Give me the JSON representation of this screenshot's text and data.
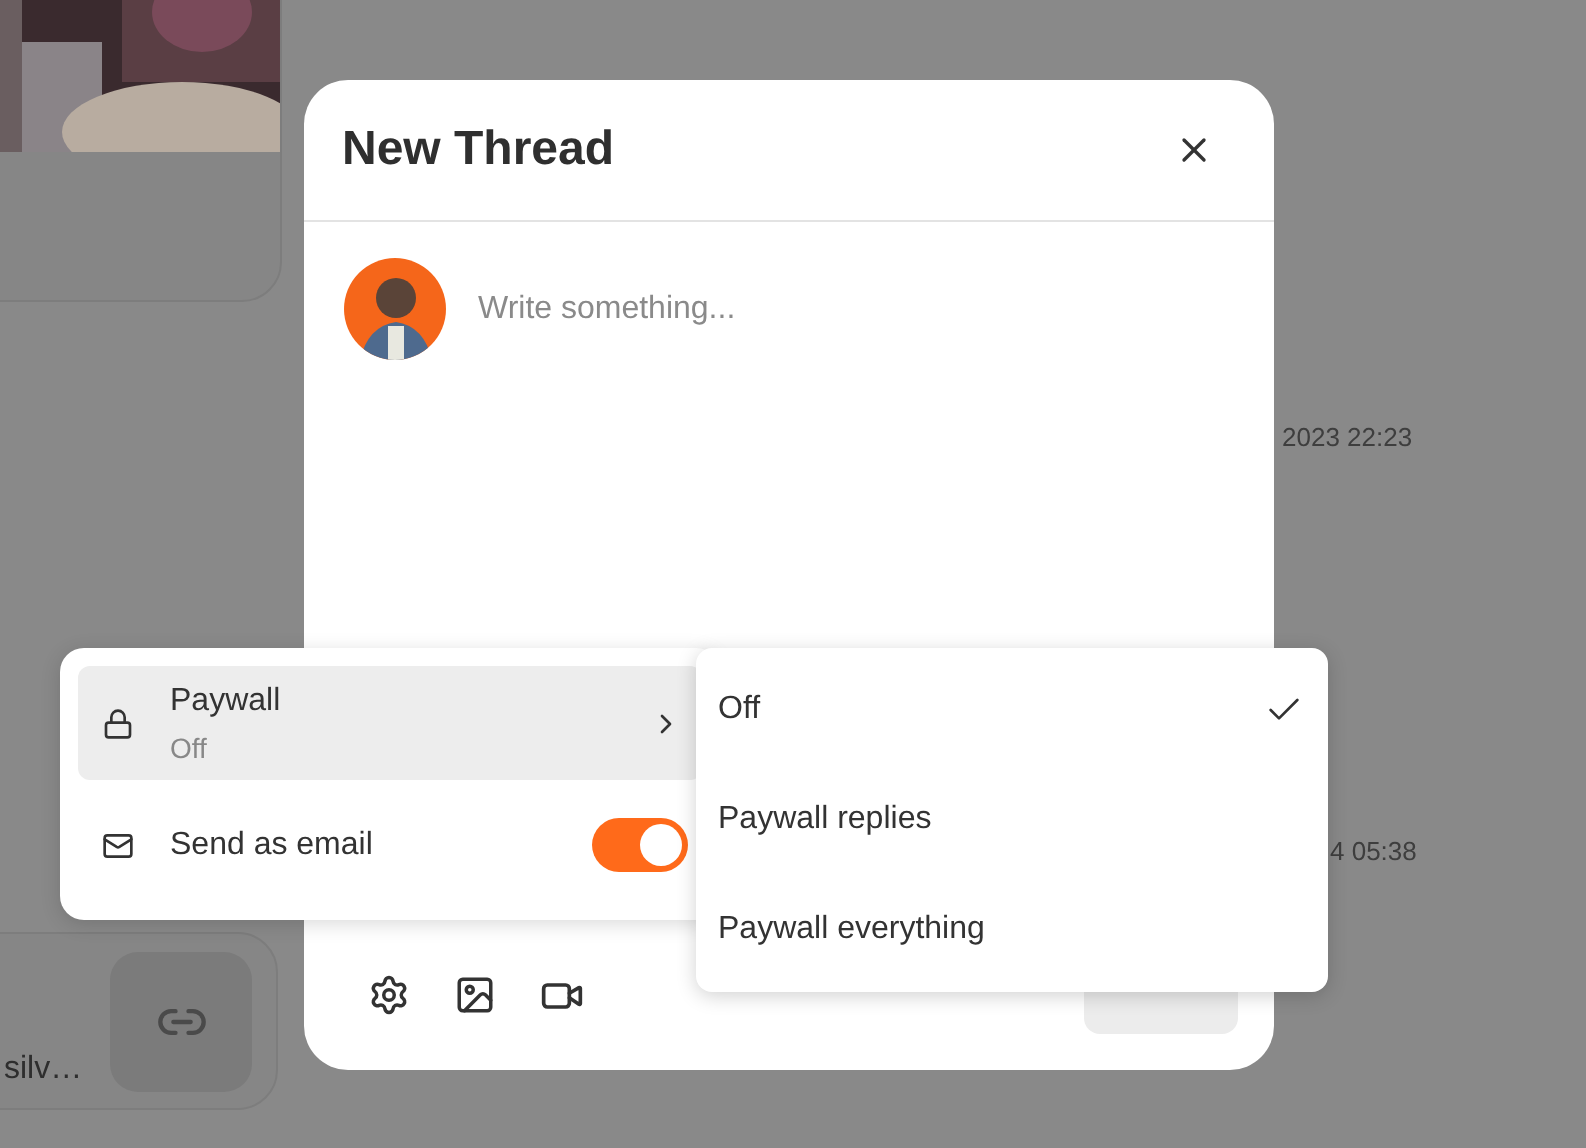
{
  "background": {
    "timestamps": [
      "2023 22:23",
      "4 05:38"
    ],
    "link_card": {
      "text": "silv…"
    }
  },
  "modal": {
    "title": "New Thread",
    "composer": {
      "placeholder": "Write something..."
    }
  },
  "settings_menu": {
    "items": [
      {
        "kind": "submenu",
        "label": "Paywall",
        "value": "Off",
        "selected": true
      },
      {
        "kind": "toggle",
        "label": "Send as email",
        "on": true
      }
    ]
  },
  "paywall_menu": {
    "options": [
      {
        "label": "Off",
        "selected": true
      },
      {
        "label": "Paywall replies",
        "selected": false
      },
      {
        "label": "Paywall everything",
        "selected": false
      }
    ]
  }
}
